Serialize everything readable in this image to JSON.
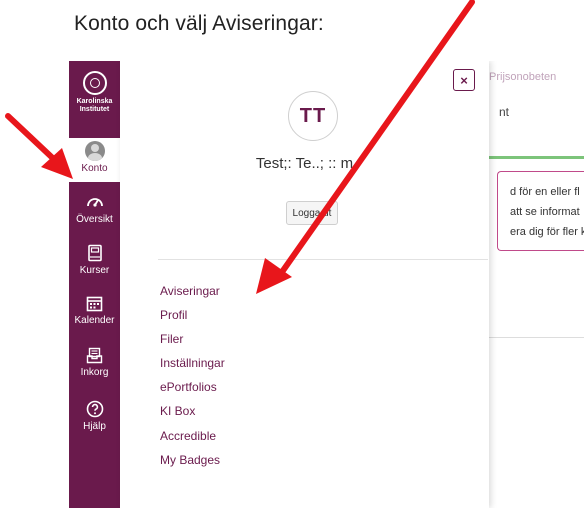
{
  "instruction": "Konto och välj Aviseringar:",
  "logo": {
    "name": "Karolinska Institutet",
    "line1": "Karolinska",
    "line2": "Institutet"
  },
  "global_nav": [
    {
      "id": "account",
      "label": "Konto",
      "icon": "user-avatar-icon",
      "active": true
    },
    {
      "id": "dashboard",
      "label": "Översikt",
      "icon": "dashboard-icon",
      "active": false
    },
    {
      "id": "courses",
      "label": "Kurser",
      "icon": "book-icon",
      "active": false
    },
    {
      "id": "calendar",
      "label": "Kalender",
      "icon": "calendar-icon",
      "active": false
    },
    {
      "id": "inbox",
      "label": "Inkorg",
      "icon": "inbox-icon",
      "active": false
    },
    {
      "id": "help",
      "label": "Hjälp",
      "icon": "help-icon",
      "active": false
    }
  ],
  "tray": {
    "close_label": "×",
    "avatar_initials": "TT",
    "user_name": "Test;:   Te..;  ::  m",
    "logout_label": "Logga ut",
    "links": [
      "Aviseringar",
      "Profil",
      "Filer",
      "Inställningar",
      "ePortfolios",
      "KI Box",
      "Accredible",
      "My Badges"
    ]
  },
  "background_page": {
    "top_text": "Prijsonobeten",
    "text_fragment": "nt",
    "notice_lines": [
      "d för en eller fl",
      "att se informat",
      "era dig för fler k"
    ]
  },
  "colors": {
    "brand": "#6a1a4c",
    "arrow": "#e8161b",
    "success": "#7cc47a",
    "alert_border": "#c04a8a"
  }
}
